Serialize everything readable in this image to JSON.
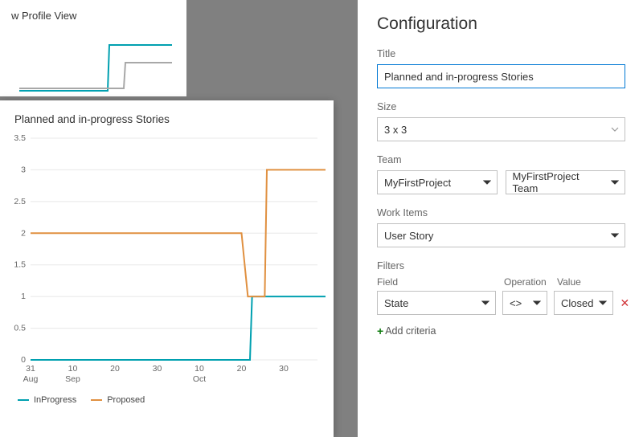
{
  "ghost": {
    "title": "w Profile View"
  },
  "modal": {
    "title": "Planned and in-progress Stories"
  },
  "legend": {
    "s1": {
      "name": "InProgress",
      "color": "#00a0b0"
    },
    "s2": {
      "name": "Proposed",
      "color": "#e09040"
    }
  },
  "config": {
    "heading": "Configuration",
    "title_label": "Title",
    "title_value": "Planned and in-progress Stories",
    "size_label": "Size",
    "size_value": "3 x 3",
    "team_label": "Team",
    "project_value": "MyFirstProject",
    "team_value": "MyFirstProject Team",
    "work_items_label": "Work Items",
    "work_items_value": "User Story",
    "filters_label": "Filters",
    "filters_head": {
      "field": "Field",
      "operation": "Operation",
      "value": "Value"
    },
    "filter_row": {
      "field": "State",
      "operation": "<>",
      "value": "Closed"
    },
    "add_criteria": "Add criteria"
  },
  "chart_data": {
    "type": "line",
    "title": "Planned and in-progress Stories",
    "xlabel": "",
    "ylabel": "",
    "ylim": [
      0,
      3.5
    ],
    "y_ticks": [
      0,
      0.5,
      1,
      1.5,
      2,
      2.5,
      3,
      3.5
    ],
    "x_ticks": [
      {
        "top": "31",
        "bottom": "Aug"
      },
      {
        "top": "10",
        "bottom": "Sep"
      },
      {
        "top": "20",
        "bottom": ""
      },
      {
        "top": "30",
        "bottom": ""
      },
      {
        "top": "10",
        "bottom": "Oct"
      },
      {
        "top": "20",
        "bottom": ""
      },
      {
        "top": "30",
        "bottom": ""
      }
    ],
    "series": [
      {
        "name": "InProgress",
        "color": "#00a0b0",
        "points": [
          [
            0,
            0
          ],
          [
            1,
            0
          ],
          [
            2,
            0
          ],
          [
            3,
            0
          ],
          [
            4,
            0
          ],
          [
            5.2,
            0
          ],
          [
            5.25,
            1
          ],
          [
            7,
            1
          ]
        ]
      },
      {
        "name": "Proposed",
        "color": "#e09040",
        "points": [
          [
            0,
            2
          ],
          [
            1,
            2
          ],
          [
            2,
            2
          ],
          [
            3,
            2
          ],
          [
            4,
            2
          ],
          [
            5,
            2
          ],
          [
            5.15,
            1
          ],
          [
            5.55,
            1
          ],
          [
            5.6,
            3
          ],
          [
            7,
            3
          ]
        ]
      }
    ]
  }
}
